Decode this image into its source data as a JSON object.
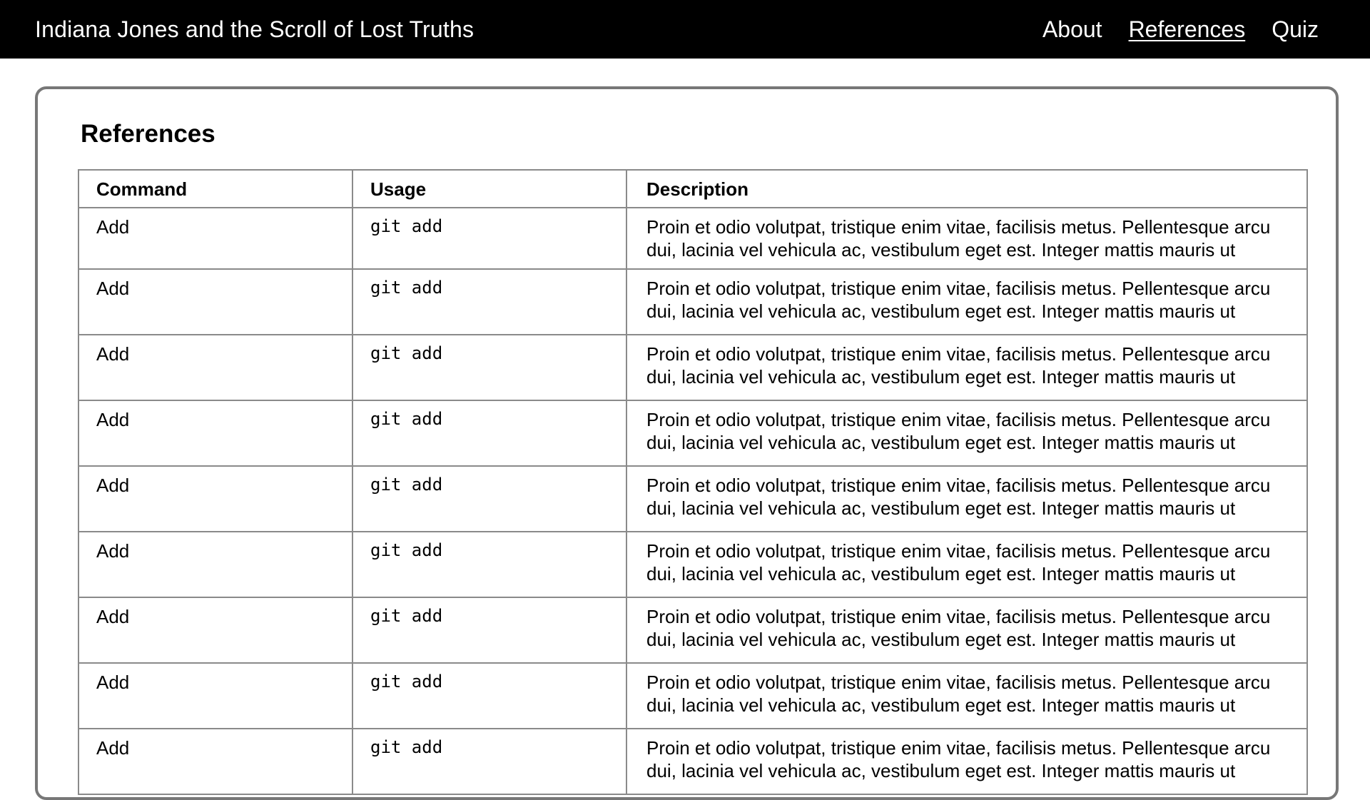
{
  "header": {
    "title": "Indiana Jones and the Scroll of Lost Truths",
    "nav": [
      {
        "label": "About",
        "active": false
      },
      {
        "label": "References",
        "active": true
      },
      {
        "label": "Quiz",
        "active": false
      }
    ]
  },
  "main": {
    "heading": "References",
    "table": {
      "columns": [
        "Command",
        "Usage",
        "Description"
      ],
      "rows": [
        {
          "command": "Add",
          "usage": "git add",
          "description": "Proin et odio volutpat, tristique enim vitae, facilisis metus. Pellentesque arcu dui, lacinia vel vehicula ac, vestibulum eget est. Integer mattis mauris ut"
        },
        {
          "command": "Add",
          "usage": "git add",
          "description": "Proin et odio volutpat, tristique enim vitae, facilisis metus. Pellentesque arcu dui, lacinia vel vehicula ac, vestibulum eget est. Integer mattis mauris ut"
        },
        {
          "command": "Add",
          "usage": "git add",
          "description": "Proin et odio volutpat, tristique enim vitae, facilisis metus. Pellentesque arcu dui, lacinia vel vehicula ac, vestibulum eget est. Integer mattis mauris ut"
        },
        {
          "command": "Add",
          "usage": "git add",
          "description": "Proin et odio volutpat, tristique enim vitae, facilisis metus. Pellentesque arcu dui, lacinia vel vehicula ac, vestibulum eget est. Integer mattis mauris ut"
        },
        {
          "command": "Add",
          "usage": "git add",
          "description": "Proin et odio volutpat, tristique enim vitae, facilisis metus. Pellentesque arcu dui, lacinia vel vehicula ac, vestibulum eget est. Integer mattis mauris ut"
        },
        {
          "command": "Add",
          "usage": "git add",
          "description": "Proin et odio volutpat, tristique enim vitae, facilisis metus. Pellentesque arcu dui, lacinia vel vehicula ac, vestibulum eget est. Integer mattis mauris ut"
        },
        {
          "command": "Add",
          "usage": "git add",
          "description": "Proin et odio volutpat, tristique enim vitae, facilisis metus. Pellentesque arcu dui, lacinia vel vehicula ac, vestibulum eget est. Integer mattis mauris ut"
        },
        {
          "command": "Add",
          "usage": "git add",
          "description": "Proin et odio volutpat, tristique enim vitae, facilisis metus. Pellentesque arcu dui, lacinia vel vehicula ac, vestibulum eget est. Integer mattis mauris ut"
        },
        {
          "command": "Add",
          "usage": "git add",
          "description": "Proin et odio volutpat, tristique enim vitae, facilisis metus. Pellentesque arcu dui, lacinia vel vehicula ac, vestibulum eget est. Integer mattis mauris ut"
        }
      ]
    }
  }
}
